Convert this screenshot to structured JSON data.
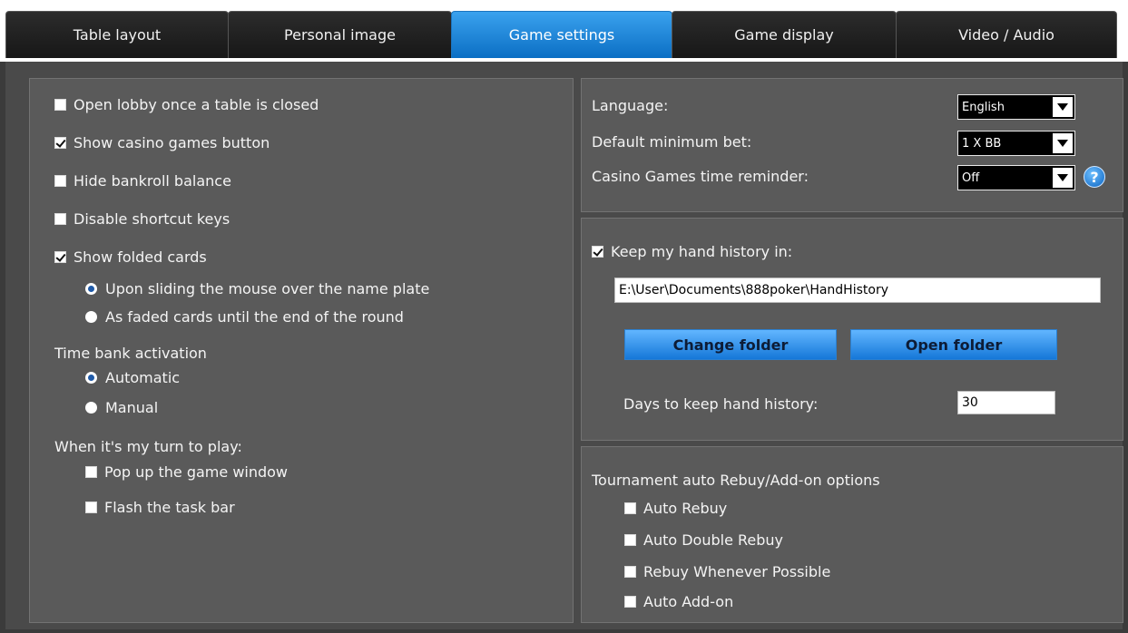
{
  "tabs": [
    {
      "label": "Table layout"
    },
    {
      "label": "Personal image"
    },
    {
      "label": "Game settings"
    },
    {
      "label": "Game display"
    },
    {
      "label": "Video / Audio"
    }
  ],
  "active_tab": "Game settings",
  "left": {
    "open_lobby": "Open lobby once a table is closed",
    "show_casino": "Show casino games button",
    "hide_bankroll": "Hide bankroll balance",
    "disable_shortcuts": "Disable shortcut keys",
    "show_folded": "Show folded cards",
    "folded_option_1": "Upon sliding the mouse over the name plate",
    "folded_option_2": "As faded cards until the end of the round",
    "time_bank_label": "Time bank activation",
    "time_bank_auto": "Automatic",
    "time_bank_manual": "Manual",
    "my_turn_label": "When it's my turn to play:",
    "popup_window": "Pop up the game window",
    "flash_taskbar": "Flash the task bar"
  },
  "settings": {
    "language_label": "Language:",
    "language_value": "English",
    "min_bet_label": "Default minimum bet:",
    "min_bet_value": "1 X BB",
    "reminder_label": "Casino Games time reminder:",
    "reminder_value": "Off",
    "help_glyph": "?"
  },
  "history": {
    "keep_label": "Keep my hand history in:",
    "path": "E:\\User\\Documents\\888poker\\HandHistory",
    "change_folder": "Change folder",
    "open_folder": "Open folder",
    "days_label": "Days to keep hand history:",
    "days_value": "30"
  },
  "tournament": {
    "title": "Tournament auto Rebuy/Add-on options",
    "auto_rebuy": "Auto Rebuy",
    "auto_double_rebuy": "Auto Double Rebuy",
    "rebuy_whenever": "Rebuy Whenever Possible",
    "auto_addon": "Auto Add-on"
  }
}
